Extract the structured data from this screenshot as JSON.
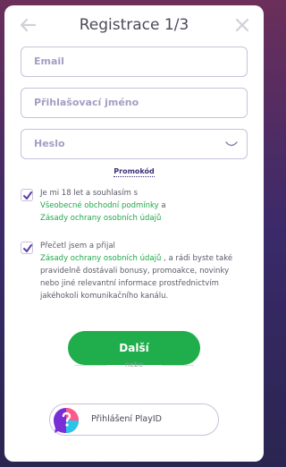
{
  "header": {
    "title": "Registrace 1/3"
  },
  "form": {
    "email_placeholder": "Email",
    "login_placeholder": "Přihlašovací jméno",
    "password_placeholder": "Heslo",
    "promo_label": "Promokód"
  },
  "consent1": {
    "text": "Je mi 18 let a souhlasím s",
    "link1": "Všeobecné obchodní podmínky",
    "mid": " a",
    "link2": "Zásady ochrany osobních údajů"
  },
  "consent2": {
    "text": "Přečetl jsem a přijal",
    "link": "Zásady ochrany osobních údajů",
    "rest": " , a rádi byste také pravidelně dostávali bonusy, promoakce, novinky nebo jiné relevantní informace prostřednictvím jakéhokoli komunikačního kanálu."
  },
  "actions": {
    "next_label": "Další",
    "or_label": "nebo",
    "playid_label": "Přihlášení PlayID"
  },
  "colors": {
    "accent": "#1fae4b",
    "brand": "#3d2f7a",
    "border": "#c9c0dc"
  }
}
